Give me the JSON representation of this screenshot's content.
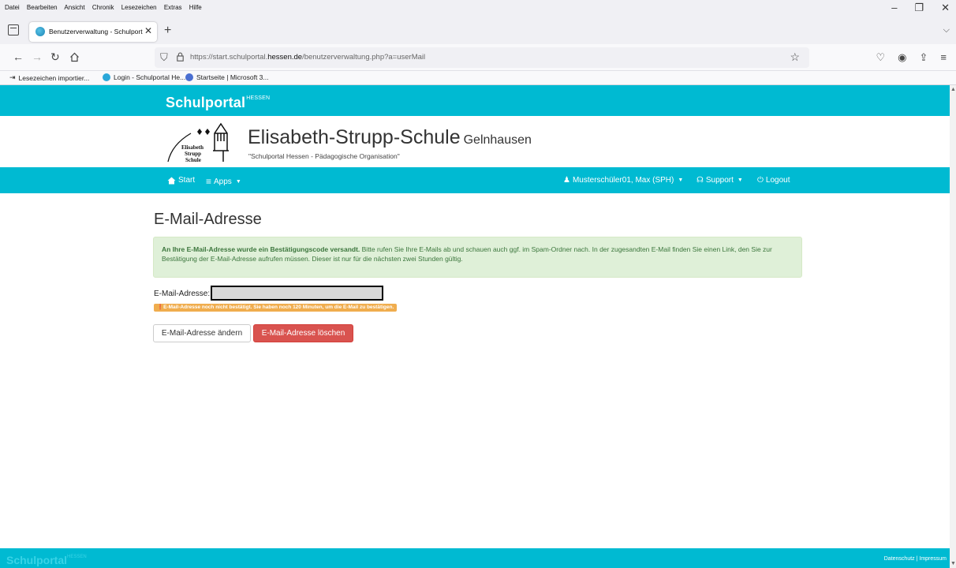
{
  "browser": {
    "menu": [
      "Datei",
      "Bearbeiten",
      "Ansicht",
      "Chronik",
      "Lesezeichen",
      "Extras",
      "Hilfe"
    ],
    "window_controls": [
      "–",
      "❐",
      "✕"
    ],
    "tab": {
      "title": "Benutzerverwaltung - Schulport",
      "close": "✕"
    },
    "new_tab": "+",
    "url_prefix": "https://start.schulportal.",
    "url_domain": "hessen.de",
    "url_suffix": "/benutzerverwaltung.php?a=userMail",
    "bookmarks": [
      "Lesezeichen importier...",
      "Login - Schulportal He...",
      "Startseite | Microsoft 3..."
    ]
  },
  "portal": {
    "brand": "Schulportal",
    "brand_sup": "HESSEN",
    "school_name": "Elisabeth-Strupp-Schule",
    "school_city": "Gelnhausen",
    "school_subtitle": "\"Schulportal Hessen - Pädagogische Organisation\"",
    "logo_text": [
      "Elisabeth",
      "Strupp",
      "Schule"
    ],
    "nav": {
      "start": "Start",
      "apps": "Apps",
      "user": "Musterschüler01, Max (SPH)",
      "support": "Support",
      "logout": "Logout"
    }
  },
  "main": {
    "title": "E-Mail-Adresse",
    "alert_bold": "An Ihre E-Mail-Adresse wurde ein Bestätigungscode versandt.",
    "alert_text": " Bitte rufen Sie Ihre E-Mails ab und schauen auch ggf. im Spam-Ordner nach. In der zugesandten E-Mail finden Sie einen Link, den Sie zur Bestätigung der E-Mail-Adresse aufrufen müssen. Dieser ist nur für die nächsten zwei Stunden gültig.",
    "email_label": "E-Mail-Adresse:",
    "email_value": "",
    "warning": "E-Mail-Adresse noch nicht bestätigt. Sie haben noch 120 Minuten, um die E-Mail zu bestätigen.",
    "btn_change": "E-Mail-Adresse ändern",
    "btn_delete": "E-Mail-Adresse löschen"
  },
  "footer": {
    "brand": "Schulportal",
    "brand_sup": "HESSEN",
    "links": "Datenschutz | Impressum"
  },
  "colors": {
    "portal_teal": "#00bad2",
    "alert_green_bg": "#dff0d8",
    "warning_orange": "#f0ad4e",
    "danger_red": "#d9534f"
  }
}
